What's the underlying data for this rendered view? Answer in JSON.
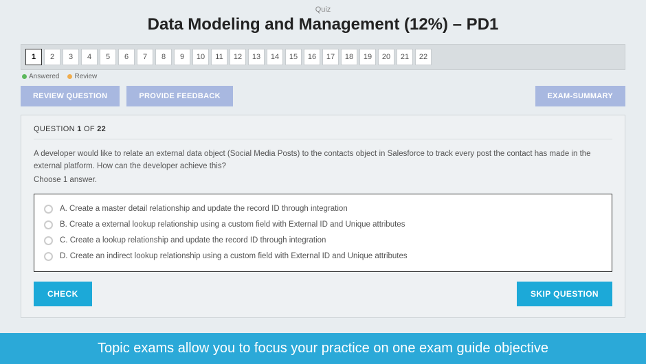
{
  "header": {
    "label": "Quiz",
    "title": "Data Modeling and Management (12%) – PD1"
  },
  "nav": {
    "numbers": [
      "1",
      "2",
      "3",
      "4",
      "5",
      "6",
      "7",
      "8",
      "9",
      "10",
      "11",
      "12",
      "13",
      "14",
      "15",
      "16",
      "17",
      "18",
      "19",
      "20",
      "21",
      "22"
    ],
    "active": 0
  },
  "legend": {
    "answered": "Answered",
    "review": "Review"
  },
  "actions": {
    "review": "REVIEW QUESTION",
    "feedback": "PROVIDE FEEDBACK",
    "summary": "EXAM-SUMMARY"
  },
  "question": {
    "label_prefix": "QUESTION ",
    "num": "1",
    "of": " OF ",
    "total": "22",
    "text": "A developer would like to relate an external data object (Social Media Posts) to the contacts object in Salesforce to track every post the contact has made in the external platform. How can the developer achieve this?",
    "instruction": "Choose 1 answer.",
    "choices": [
      "A. Create a master detail relationship and update the record ID through integration",
      "B. Create a external lookup relationship using a custom field with External ID and Unique attributes",
      "C. Create a lookup relationship and update the record ID through integration",
      "D. Create an indirect lookup relationship using a custom field with External ID and Unique attributes"
    ]
  },
  "bottom": {
    "check": "CHECK",
    "skip": "SKIP QUESTION"
  },
  "banner": "Topic exams allow you to focus your practice on one exam guide objective"
}
